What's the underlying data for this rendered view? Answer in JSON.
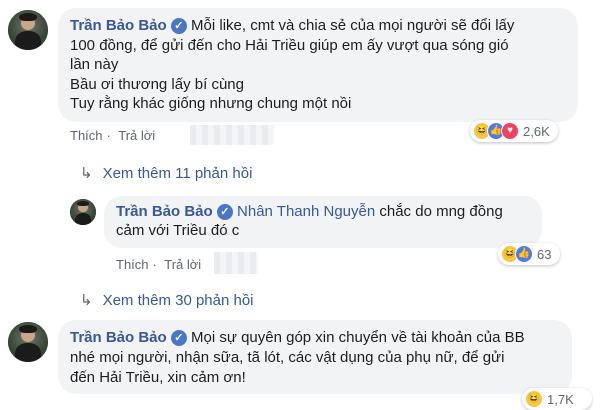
{
  "comments": [
    {
      "author": "Trần Bảo Bảo",
      "lines": [
        "Mỗi like, cmt và chia sẻ của mọi người sẽ đổi lấy",
        "100 đồng, để gửi đến cho Hải Triều giúp em ấy vượt qua sóng gió",
        "lần này",
        "Bầu ơi thương lấy bí cùng",
        "Tuy rằng khác giống nhưng chung một nồi"
      ],
      "like": "Thích",
      "reply": "Trả lời",
      "reactions": "2,6K"
    },
    {
      "author": "Trần Bảo Bảo",
      "tag": "Nhân Thanh Nguyễn",
      "text_line1": "chắc do mng đồng",
      "text_line2": "cảm với Triều đó c",
      "like": "Thích",
      "reply": "Trả lời",
      "reactions": "63"
    },
    {
      "author": "Trần Bảo Bảo",
      "lines": [
        "Mọi sự quyên góp xin chuyển về tài khoản của BB",
        "nhé mọi người, nhận sữa, tã lót, các vật dụng của phụ nữ, để gửi",
        "đến Hải Triều, xin cảm ơn!"
      ],
      "reactions": "1,7K"
    }
  ],
  "view_more": [
    "Xem thêm 11 phản hồi",
    "Xem thêm 30 phản hồi"
  ],
  "icons": {
    "verified": "check",
    "reaction_haha": "haha-emoji",
    "reaction_like": "thumbs-up",
    "reaction_love": "heart",
    "view_more_arrow": "reply-arrow"
  },
  "colors": {
    "link": "#385898",
    "bubble": "#f2f3f5",
    "meta": "#606770"
  }
}
